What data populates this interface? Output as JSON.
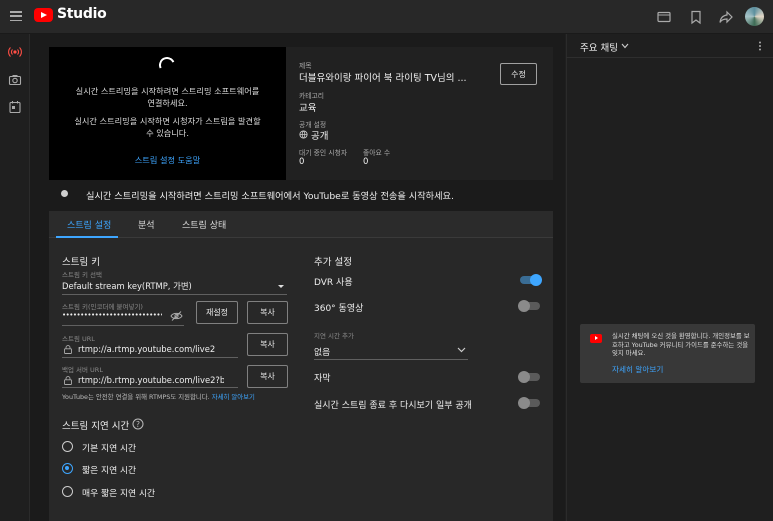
{
  "app": {
    "title": "Studio"
  },
  "preview": {
    "line1": "실시간 스트리밍을 시작하려면 스트리밍 소프트웨어를 연결하세요.",
    "line2": "실시간 스트리밍을 시작하면 시청자가 스트림을 발견할 수 있습니다.",
    "help_link": "스트림 설정 도움말"
  },
  "info": {
    "title_label": "제목",
    "title_value": "더블유와이랑 파이어 북 라이팅 TV님의 ...",
    "category_label": "카테고리",
    "category_value": "교육",
    "visibility_label": "공개 설정",
    "visibility_value": "공개",
    "viewers_label": "대기 중인 시청자",
    "viewers_value": "0",
    "likes_label": "좋아요 수",
    "likes_value": "0",
    "edit_button": "수정"
  },
  "status": {
    "message": "실시간 스트리밍을 시작하려면 스트리밍 소프트웨어에서 YouTube로 동영상 전송을 시작하세요."
  },
  "tabs": [
    {
      "label": "스트림 설정",
      "active": true
    },
    {
      "label": "분석",
      "active": false
    },
    {
      "label": "스트림 상태",
      "active": false
    }
  ],
  "stream_key": {
    "section_title": "스트림 키",
    "select_label": "스트림 키 선택",
    "select_value": "Default stream key(RTMP, 가변)",
    "key_label": "스트림 키(인코더에 붙여넣기)",
    "key_value": "••••••••••••••••••••••••••••",
    "reset_button": "재설정",
    "copy_button": "복사",
    "url_label": "스트림 URL",
    "url_value": "rtmp://a.rtmp.youtube.com/live2",
    "backup_label": "백업 서버 URL",
    "backup_value": "rtmp://b.rtmp.youtube.com/live2?backup=1",
    "rtmps_note": "YouTube는 안전한 연결을 위해 RTMPS도 지원합니다.",
    "rtmps_link": "자세히 알아보기"
  },
  "latency": {
    "section_title": "스트림 지연 시간",
    "options": [
      {
        "label": "기본 지연 시간",
        "selected": false
      },
      {
        "label": "짧은 지연 시간",
        "selected": true
      },
      {
        "label": "매우 짧은 지연 시간",
        "selected": false
      }
    ]
  },
  "additional": {
    "section_title": "추가 설정",
    "dvr_label": "DVR 사용",
    "dvr_on": true,
    "vr360_label": "360° 동영상",
    "vr360_on": false,
    "delay_label": "지연 시간 추가",
    "delay_value": "없음",
    "captions_label": "자막",
    "captions_on": false,
    "replay_label": "실시간 스트림 종료 후 다시보기 일부 공개",
    "replay_on": false
  },
  "chat": {
    "title": "주요 채팅",
    "notice_text": "실시간 채팅에 오신 것을 환영합니다. 개인정보를 보호하고 YouTube 커뮤니티 가이드를 준수하는 것을 잊지 마세요.",
    "notice_link": "자세히 알아보기"
  },
  "colors": {
    "accent": "#3ea6ff",
    "brand": "#ff0000"
  }
}
